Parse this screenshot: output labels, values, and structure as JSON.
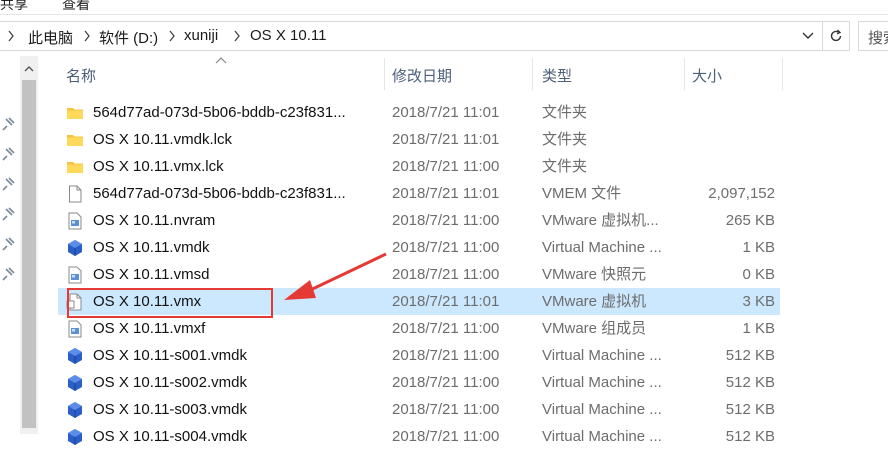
{
  "ribbon": {
    "items": [
      "共享",
      "查看"
    ]
  },
  "address": {
    "breadcrumbs": [
      "此电脑",
      "软件 (D:)",
      "xuniji",
      "OS X 10.11"
    ],
    "search_placeholder": "搜索"
  },
  "columns": {
    "name": "名称",
    "modified": "修改日期",
    "type": "类型",
    "size": "大小"
  },
  "rows": [
    {
      "icon": "folder-icon",
      "name": "564d77ad-073d-5b06-bddb-c23f831...",
      "modified": "2018/7/21 11:01",
      "type": "文件夹",
      "size": ""
    },
    {
      "icon": "folder-icon",
      "name": "OS X 10.11.vmdk.lck",
      "modified": "2018/7/21 11:01",
      "type": "文件夹",
      "size": ""
    },
    {
      "icon": "folder-icon",
      "name": "OS X 10.11.vmx.lck",
      "modified": "2018/7/21 11:00",
      "type": "文件夹",
      "size": ""
    },
    {
      "icon": "file-icon",
      "name": "564d77ad-073d-5b06-bddb-c23f831...",
      "modified": "2018/7/21 11:01",
      "type": "VMEM 文件",
      "size": "2,097,152"
    },
    {
      "icon": "vmware-config-icon",
      "name": "OS X 10.11.nvram",
      "modified": "2018/7/21 11:00",
      "type": "VMware 虚拟机...",
      "size": "265 KB"
    },
    {
      "icon": "virtual-disk-icon",
      "name": "OS X 10.11.vmdk",
      "modified": "2018/7/21 11:00",
      "type": "Virtual Machine ...",
      "size": "1 KB"
    },
    {
      "icon": "vmware-config-icon",
      "name": "OS X 10.11.vmsd",
      "modified": "2018/7/21 11:00",
      "type": "VMware 快照元",
      "size": "0 KB"
    },
    {
      "icon": "vmx-file-icon",
      "name": "OS X 10.11.vmx",
      "modified": "2018/7/21 11:01",
      "type": "VMware 虚拟机",
      "size": "3 KB",
      "selected": true
    },
    {
      "icon": "vmware-config-icon",
      "name": "OS X 10.11.vmxf",
      "modified": "2018/7/21 11:00",
      "type": "VMware 组成员",
      "size": "1 KB"
    },
    {
      "icon": "virtual-disk-icon",
      "name": "OS X 10.11-s001.vmdk",
      "modified": "2018/7/21 11:00",
      "type": "Virtual Machine ...",
      "size": "512 KB"
    },
    {
      "icon": "virtual-disk-icon",
      "name": "OS X 10.11-s002.vmdk",
      "modified": "2018/7/21 11:00",
      "type": "Virtual Machine ...",
      "size": "512 KB"
    },
    {
      "icon": "virtual-disk-icon",
      "name": "OS X 10.11-s003.vmdk",
      "modified": "2018/7/21 11:00",
      "type": "Virtual Machine ...",
      "size": "512 KB"
    },
    {
      "icon": "virtual-disk-icon",
      "name": "OS X 10.11-s004.vmdk",
      "modified": "2018/7/21 11:00",
      "type": "Virtual Machine ...",
      "size": "512 KB"
    }
  ],
  "colors": {
    "selected_row": "#cce8ff",
    "annotation": "#e53935",
    "header_text": "#4c607a"
  }
}
